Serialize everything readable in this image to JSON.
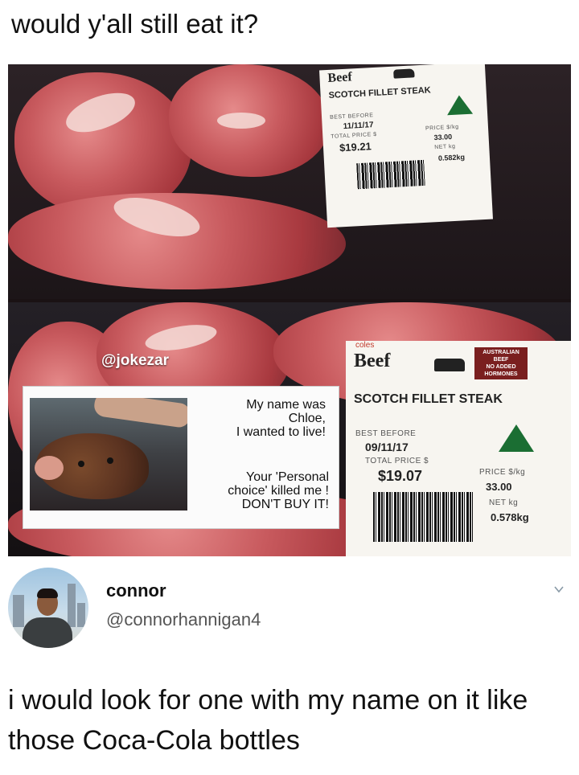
{
  "post": {
    "header_text": "would y'all still eat it?",
    "watermark": "@jokezar"
  },
  "top_label": {
    "brand": "Beef",
    "product": "SCOTCH FILLET STEAK",
    "best_before_label": "BEST BEFORE",
    "best_before": "11/11/17",
    "total_price_label": "TOTAL PRICE $",
    "total_price": "$19.21",
    "price_per_kg_label": "PRICE $/kg",
    "price_per_kg": "33.00",
    "net_label": "NET kg",
    "net_weight": "0.582kg"
  },
  "bottom_label": {
    "store": "coles",
    "brand": "Beef",
    "badge_line1": "AUSTRALIAN",
    "badge_line2": "BEEF",
    "badge_line3": "NO ADDED",
    "badge_line4": "HORMONES",
    "product": "SCOTCH FILLET STEAK",
    "best_before_label": "BEST BEFORE",
    "best_before": "09/11/17",
    "total_price_label": "TOTAL PRICE $",
    "total_price": "$19.07",
    "price_per_kg_label": "PRICE $/kg",
    "price_per_kg": "33.00",
    "net_label": "NET kg",
    "net_weight": "0.578kg"
  },
  "chloe_card": {
    "line1": "My name was",
    "line2": "Chloe,",
    "line3": "I wanted to live!",
    "line4": "Your 'Personal",
    "line5": "choice' killed me !",
    "line6": "DON'T BUY IT!"
  },
  "reply": {
    "name": "connor",
    "handle": "@connorhannigan4",
    "text": "i would look for one with my name on it like those Coca-Cola bottles"
  },
  "icons": {
    "more": "chevron-down-icon"
  }
}
